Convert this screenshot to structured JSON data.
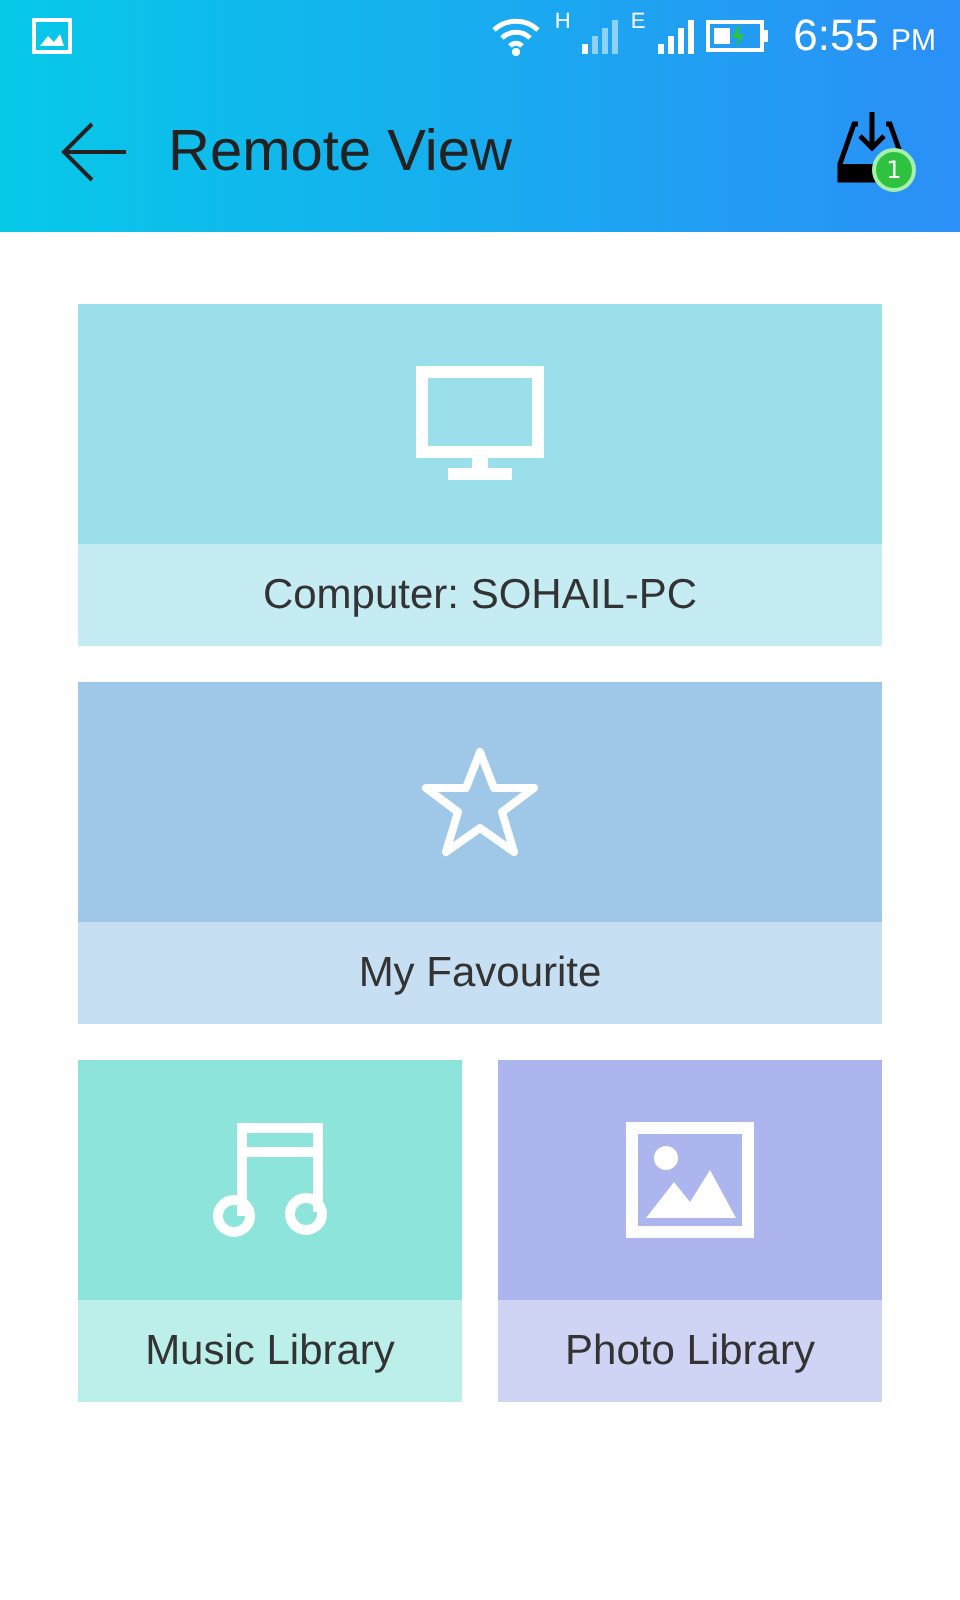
{
  "status_bar": {
    "network_1": "H",
    "network_2": "E",
    "time": "6:55",
    "meridiem": "PM"
  },
  "app_bar": {
    "title": "Remote View",
    "badge": "1"
  },
  "tiles": [
    {
      "kind": "computer",
      "label": "Computer: SOHAIL-PC",
      "wide": true,
      "color": "#9adfe9"
    },
    {
      "kind": "star",
      "label": "My Favourite",
      "wide": true,
      "color": "#9fc8e8"
    },
    {
      "kind": "music",
      "label": "Music Library",
      "wide": false,
      "color": "#8ce4da"
    },
    {
      "kind": "photo",
      "label": "Photo Library",
      "wide": false,
      "color": "#adb5ee"
    }
  ]
}
